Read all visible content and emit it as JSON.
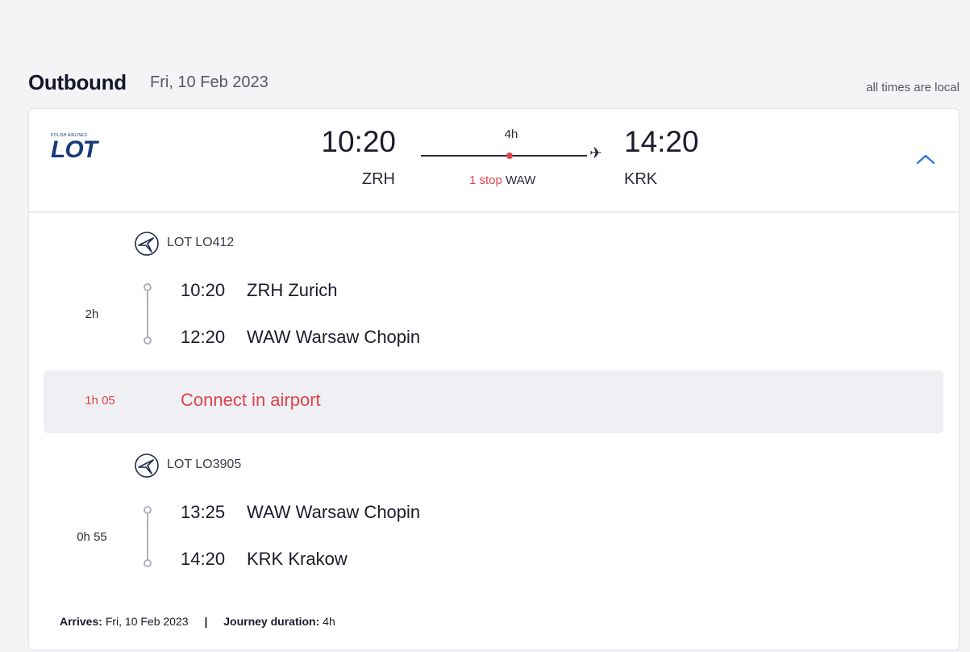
{
  "header": {
    "title": "Outbound",
    "date": "Fri, 10 Feb 2023",
    "times_note": "all times are local"
  },
  "summary": {
    "airline_logo_small": "POLISH AIRLINES",
    "airline_logo": "LOT",
    "departure_time": "10:20",
    "departure_code": "ZRH",
    "arrival_time": "14:20",
    "arrival_code": "KRK",
    "duration": "4h",
    "stops_label": "1 stop",
    "stop_airport": "WAW",
    "expand_icon": "chevron-up-icon",
    "plane_icon": "plane-icon"
  },
  "segments": [
    {
      "flight": "LOT LO412",
      "duration": "2h",
      "from_time": "10:20",
      "from": "ZRH Zurich",
      "to_time": "12:20",
      "to": "WAW Warsaw Chopin"
    },
    {
      "flight": "LOT LO3905",
      "duration": "0h 55",
      "from_time": "13:25",
      "from": "WAW Warsaw Chopin",
      "to_time": "14:20",
      "to": "KRK Krakow"
    }
  ],
  "connection": {
    "duration": "1h 05",
    "label": "Connect in airport"
  },
  "footer": {
    "arrives_label": "Arrives:",
    "arrives_value": "Fri, 10 Feb 2023",
    "separator": "|",
    "duration_label": "Journey duration:",
    "duration_value": "4h"
  },
  "colors": {
    "accent_red": "#e0424e",
    "link_blue": "#2f7be0",
    "brand_navy": "#173a7a"
  }
}
